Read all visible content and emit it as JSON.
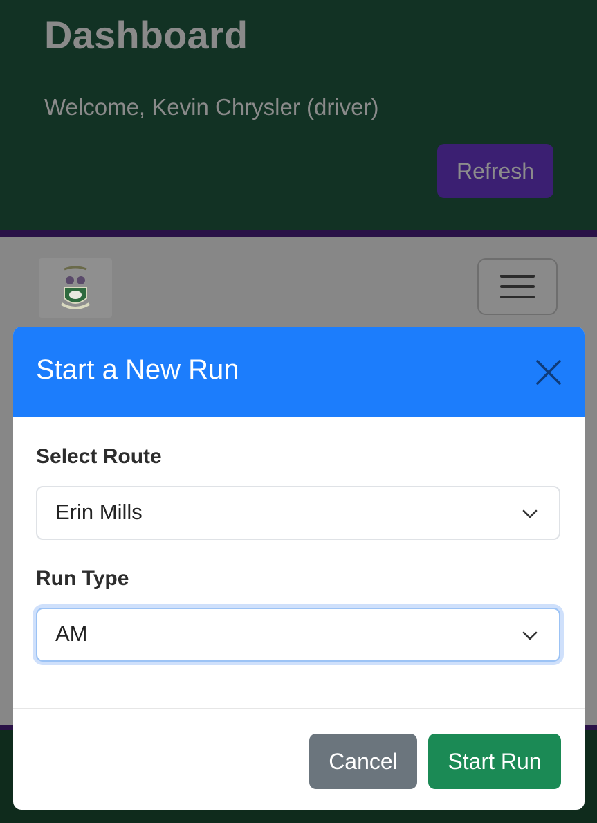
{
  "header": {
    "title": "Dashboard",
    "welcome": "Welcome, Kevin Chrysler (driver)",
    "refresh_label": "Refresh"
  },
  "navbar": {
    "logo_icon": "school-crest-logo",
    "menu_icon": "hamburger-menu-icon"
  },
  "modal": {
    "title": "Start a New Run",
    "close_icon": "close-icon",
    "route": {
      "label": "Select Route",
      "value": "Erin Mills"
    },
    "run_type": {
      "label": "Run Type",
      "value": "AM"
    },
    "cancel_label": "Cancel",
    "start_label": "Start Run"
  },
  "colors": {
    "modal_header": "#1c7dfc",
    "start_button": "#1b8a55",
    "cancel_button": "#6b757d",
    "refresh_button": "#3b1f72",
    "header_bg": "#123224"
  }
}
